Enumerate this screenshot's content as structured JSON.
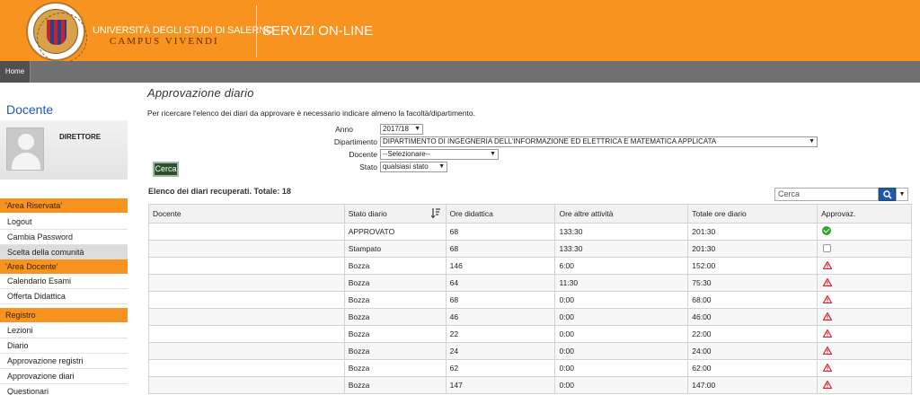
{
  "header": {
    "university": "UNIVERSITÀ DEGLI STUDI DI SALERNO",
    "motto": "CAMPUS VIVENDI",
    "service": "SERVIZI ON-LINE"
  },
  "nav": {
    "home": "Home"
  },
  "sidebar": {
    "title": "Docente",
    "role": "DIRETTORE",
    "sections": [
      {
        "label": "'Area Riservata'",
        "items": [
          "Logout",
          "Cambia Password"
        ]
      },
      {
        "label": "Scelta della comunità",
        "items": []
      },
      {
        "label": "'Area Docente'",
        "items": [
          "Calendario Esami",
          "Offerta Didattica"
        ]
      },
      {
        "label": "Registro",
        "items": [
          "Lezioni",
          "Diario",
          "Approvazione registri",
          "Approvazione diari",
          "Questionari"
        ]
      }
    ]
  },
  "main": {
    "title": "Approvazione diario",
    "instructions": "Per ricercare l'elenco dei diari da approvare è necessario indicare almeno la facoltà/dipartimento.",
    "filters": {
      "anno_label": "Anno",
      "anno_value": "2017/18",
      "dipartimento_label": "Dipartimento",
      "dipartimento_value": "DIPARTIMENTO DI INGEGNERIA DELL'INFORMAZIONE ED ELETTRICA E MATEMATICA APPLICATA",
      "docente_label": "Docente",
      "docente_value": "--Selezionare--",
      "stato_label": "Stato",
      "stato_value": "qualsiasi stato"
    },
    "search_button": "Cerca",
    "list_title": "Elenco dei diari recuperati. Totale: 18",
    "search_placeholder": "Cerca",
    "table": {
      "headers": [
        "Docente",
        "Stato diario",
        "Ore didattica",
        "Ore altre attività",
        "Totale ore diario",
        "Approvaz."
      ],
      "rows": [
        {
          "stato": "APPROVATO",
          "ore_did": "68",
          "ore_altre": "133:30",
          "totale": "201:30",
          "approv": "approved"
        },
        {
          "stato": "Stampato",
          "ore_did": "68",
          "ore_altre": "133:30",
          "totale": "201:30",
          "approv": "checkbox"
        },
        {
          "stato": "Bozza",
          "ore_did": "146",
          "ore_altre": "6:00",
          "totale": "152:00",
          "approv": "warning"
        },
        {
          "stato": "Bozza",
          "ore_did": "64",
          "ore_altre": "11:30",
          "totale": "75:30",
          "approv": "warning"
        },
        {
          "stato": "Bozza",
          "ore_did": "68",
          "ore_altre": "0:00",
          "totale": "68:00",
          "approv": "warning"
        },
        {
          "stato": "Bozza",
          "ore_did": "46",
          "ore_altre": "0:00",
          "totale": "46:00",
          "approv": "warning"
        },
        {
          "stato": "Bozza",
          "ore_did": "22",
          "ore_altre": "0:00",
          "totale": "22:00",
          "approv": "warning"
        },
        {
          "stato": "Bozza",
          "ore_did": "24",
          "ore_altre": "0:00",
          "totale": "24:00",
          "approv": "warning"
        },
        {
          "stato": "Bozza",
          "ore_did": "62",
          "ore_altre": "0:00",
          "totale": "62:00",
          "approv": "warning"
        },
        {
          "stato": "Bozza",
          "ore_did": "147",
          "ore_altre": "0:00",
          "totale": "147:00",
          "approv": "warning"
        }
      ]
    }
  },
  "colors": {
    "brand_orange": "#f7931e",
    "nav_grey": "#707070",
    "link_blue": "#1f5aa8",
    "approved_green": "#2fa52f",
    "warning_red": "#d9232d"
  },
  "icons": {
    "approved": "check-circle-icon",
    "checkbox": "checkbox-icon",
    "warning": "warning-triangle-icon",
    "search": "magnifier-icon",
    "sort": "sort-desc-icon"
  }
}
